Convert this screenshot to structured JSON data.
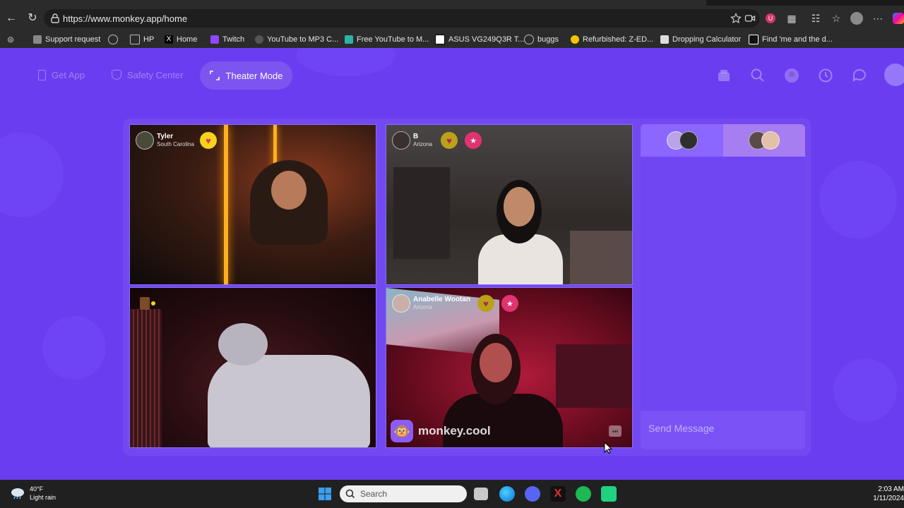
{
  "browser": {
    "url": "https://www.monkey.app/home",
    "bookmarks": [
      {
        "label": "Support request",
        "color": "#9aa0a6"
      },
      {
        "label": "",
        "color": "#9aa0a6"
      },
      {
        "label": "HP",
        "color": "#9aa0a6"
      },
      {
        "label": "Home",
        "color": "#ffffff"
      },
      {
        "label": "Twitch",
        "color": "#9146ff"
      },
      {
        "label": "YouTube to MP3 C...",
        "color": "#444444"
      },
      {
        "label": "Free YouTube to M...",
        "color": "#2bb3a5"
      },
      {
        "label": "ASUS VG249Q3R T...",
        "color": "#ffffff"
      },
      {
        "label": "buggs",
        "color": "#9aa0a6"
      },
      {
        "label": "Refurbished: Z-ED...",
        "color": "#f5c400"
      },
      {
        "label": "Dropping Calculator",
        "color": "#dddddd"
      },
      {
        "label": "Find 'me and the d...",
        "color": "#ffffff"
      }
    ]
  },
  "header": {
    "get_app": "Get App",
    "safety_center": "Safety Center",
    "theater_mode": "Theater Mode"
  },
  "tiles": [
    {
      "name": "Tyler",
      "location": "South Carolina"
    },
    {
      "name": "B",
      "location": "Arizona"
    },
    {
      "name": "",
      "location": ""
    },
    {
      "name": "Anabelle Wootan",
      "location": "Arizona"
    }
  ],
  "brand": {
    "text": "monkey.cool"
  },
  "chat": {
    "placeholder": "Send Message"
  },
  "taskbar": {
    "temperature": "40°F",
    "weather": "Light rain",
    "search_placeholder": "Search",
    "time": "2:03 AM",
    "date": "1/11/2024"
  },
  "colors": {
    "page_bg": "#6a3ef0",
    "chat_bg": "#7046f3",
    "heart_yellow": "#f7d21a",
    "badge_pink": "#e0336f"
  }
}
